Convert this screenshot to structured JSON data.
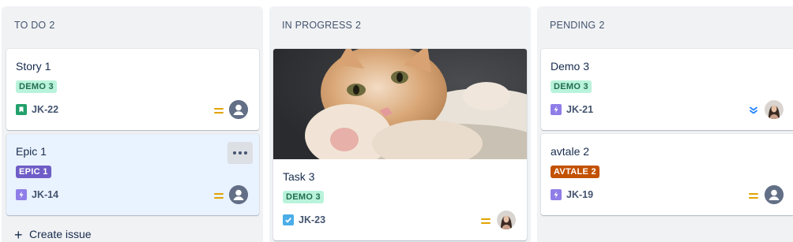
{
  "columns": [
    {
      "title": "TO DO",
      "count": "2",
      "cards": [
        {
          "title": "Story 1",
          "label": "DEMO 3",
          "key": "JK-22",
          "type": "story-icon",
          "priority": "medium-priority-icon",
          "assignee": "unassigned-avatar"
        },
        {
          "title": "Epic 1",
          "label": "EPIC 1",
          "key": "JK-14",
          "type": "epic-icon",
          "priority": "medium-priority-icon",
          "assignee": "unassigned-avatar"
        }
      ],
      "create_label": "Create issue"
    },
    {
      "title": "IN PROGRESS",
      "count": "2",
      "cards": [
        {
          "title": "Task 3",
          "label": "DEMO 3",
          "key": "JK-23",
          "type": "task-icon",
          "priority": "medium-priority-icon",
          "assignee": "user-avatar",
          "cover": "kitten-photo"
        }
      ]
    },
    {
      "title": "PENDING",
      "count": "2",
      "cards": [
        {
          "title": "Demo 3",
          "label": "DEMO 3",
          "key": "JK-21",
          "type": "epic-icon",
          "priority": "lowest-priority-icon",
          "assignee": "user-avatar"
        },
        {
          "title": "avtale 2",
          "label": "AVTALE 2",
          "key": "JK-19",
          "type": "epic-icon",
          "priority": "medium-priority-icon",
          "assignee": "unassigned-avatar"
        }
      ]
    }
  ],
  "colors": {
    "story": "#22a06b",
    "epic": "#8f7ee7",
    "task": "#4bade8",
    "priority_medium": "#e2a300",
    "priority_low": "#2684ff"
  }
}
